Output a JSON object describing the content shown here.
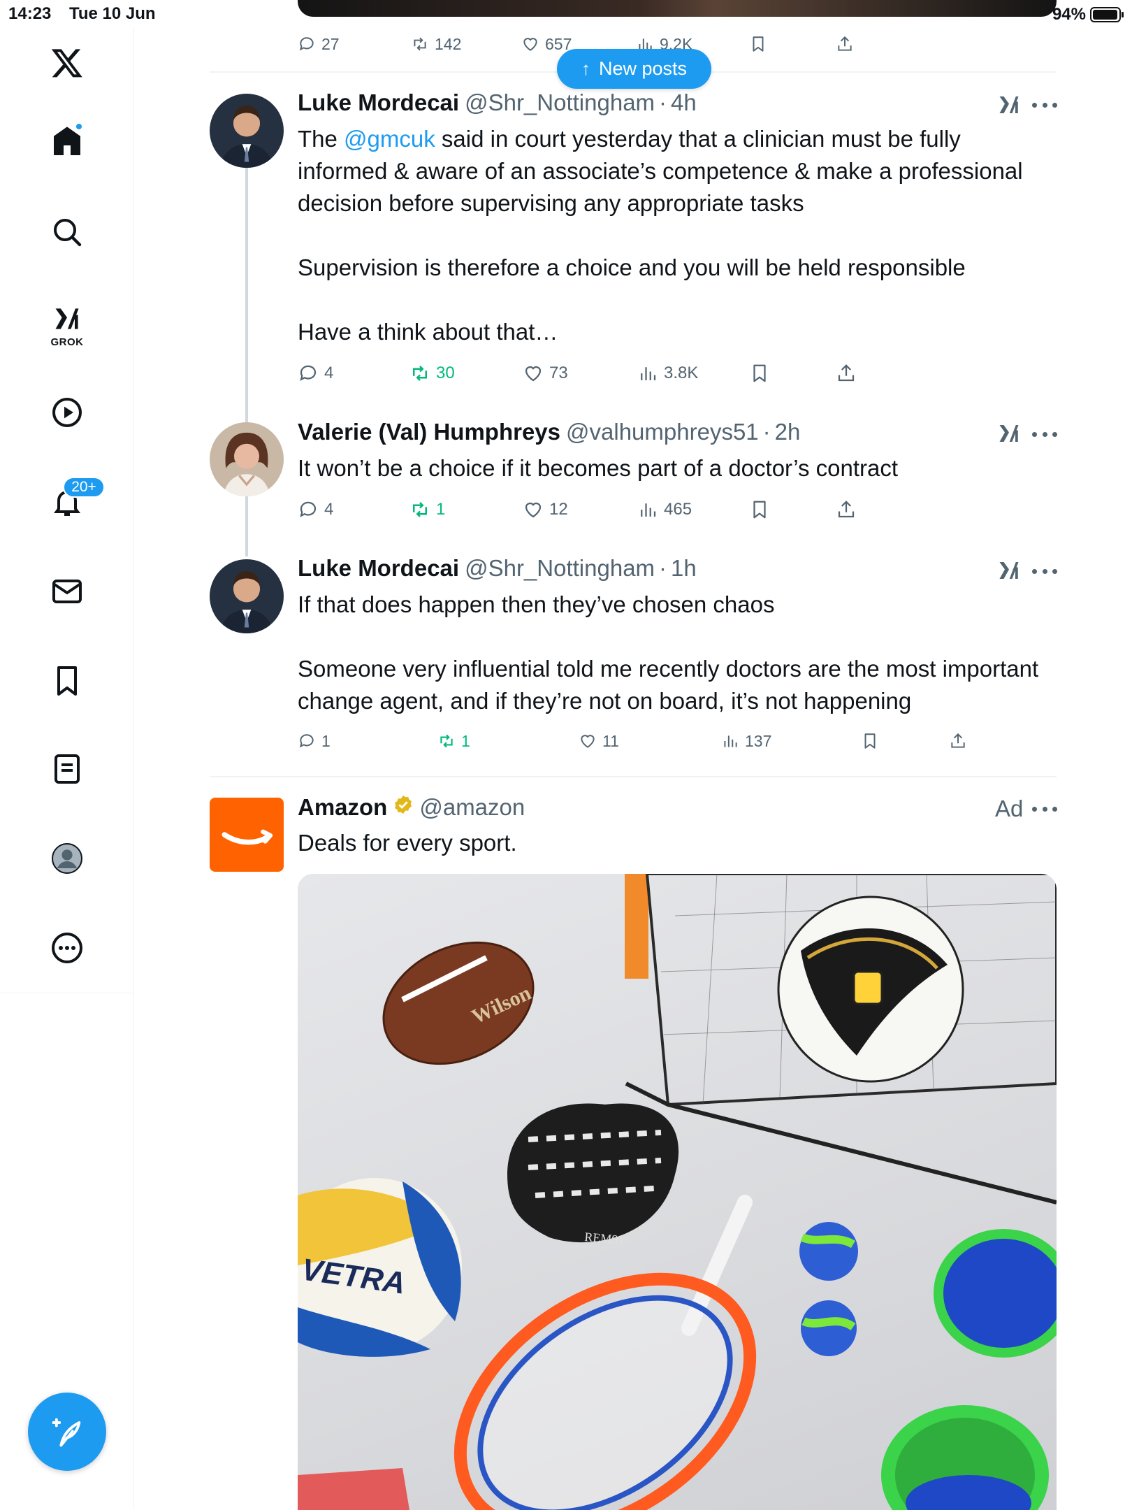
{
  "status_bar": {
    "time": "14:23",
    "date": "Tue 10 Jun",
    "battery": "94%"
  },
  "sidebar": {
    "items": [
      {
        "name": "x-logo",
        "icon": "x-logo-icon"
      },
      {
        "name": "home",
        "icon": "home-icon"
      },
      {
        "name": "search",
        "icon": "search-icon"
      },
      {
        "name": "grok",
        "icon": "grok-icon",
        "label": "GROK"
      },
      {
        "name": "video",
        "icon": "play-icon"
      },
      {
        "name": "notifications",
        "icon": "bell-icon",
        "badge": "20+"
      },
      {
        "name": "messages",
        "icon": "mail-icon"
      },
      {
        "name": "bookmarks",
        "icon": "bookmark-icon"
      },
      {
        "name": "lists",
        "icon": "list-icon"
      },
      {
        "name": "profile",
        "icon": "avatar-icon"
      },
      {
        "name": "more",
        "icon": "more-circle-icon"
      }
    ],
    "compose_icon": "compose-feather-icon"
  },
  "new_posts": {
    "label": "New posts"
  },
  "previous_post": {
    "stats": {
      "replies": "27",
      "reposts": "142",
      "likes": "657",
      "views": "9.2K"
    }
  },
  "posts": [
    {
      "name": "Luke Mordecai",
      "handle": "@Shr_Nottingham",
      "age": "4h",
      "text_parts": {
        "p1_pre": "The ",
        "p1_mention": "@gmcuk",
        "p1_post": " said in court yesterday that a clinician must be fully informed & aware of an associate’s competence & make a professional decision before supervising any appropriate tasks",
        "p2": "Supervision is therefore a choice and you will be held responsible",
        "p3": "Have a think about that…"
      },
      "stats": {
        "replies": "4",
        "reposts": "30",
        "likes": "73",
        "views": "3.8K"
      }
    },
    {
      "name": "Valerie (Val) Humphreys",
      "handle": "@valhumphreys51",
      "age": "2h",
      "text": "It won’t be a choice if it becomes part of a doctor’s contract",
      "stats": {
        "replies": "4",
        "reposts": "1",
        "likes": "12",
        "views": "465"
      }
    },
    {
      "name": "Luke Mordecai",
      "handle": "@Shr_Nottingham",
      "age": "1h",
      "text_parts": {
        "p1": "If that does happen then they’ve chosen chaos",
        "p2": "Someone very influential told me recently doctors are the most important change agent, and if they’re not on board, it’s not happening"
      },
      "stats": {
        "replies": "1",
        "reposts": "1",
        "likes": "11",
        "views": "137"
      }
    }
  ],
  "ad": {
    "name": "Amazon",
    "handle": "@amazon",
    "ad_label": "Ad",
    "text": "Deals for every sport.",
    "brand_color": "#ff6200",
    "image_text": {
      "football": "Wilson",
      "volleyball": "VETRA",
      "glove": "REM91"
    }
  },
  "colors": {
    "accent": "#1d9bf0",
    "repost": "#00ba7c",
    "secondary_text": "#536471"
  }
}
